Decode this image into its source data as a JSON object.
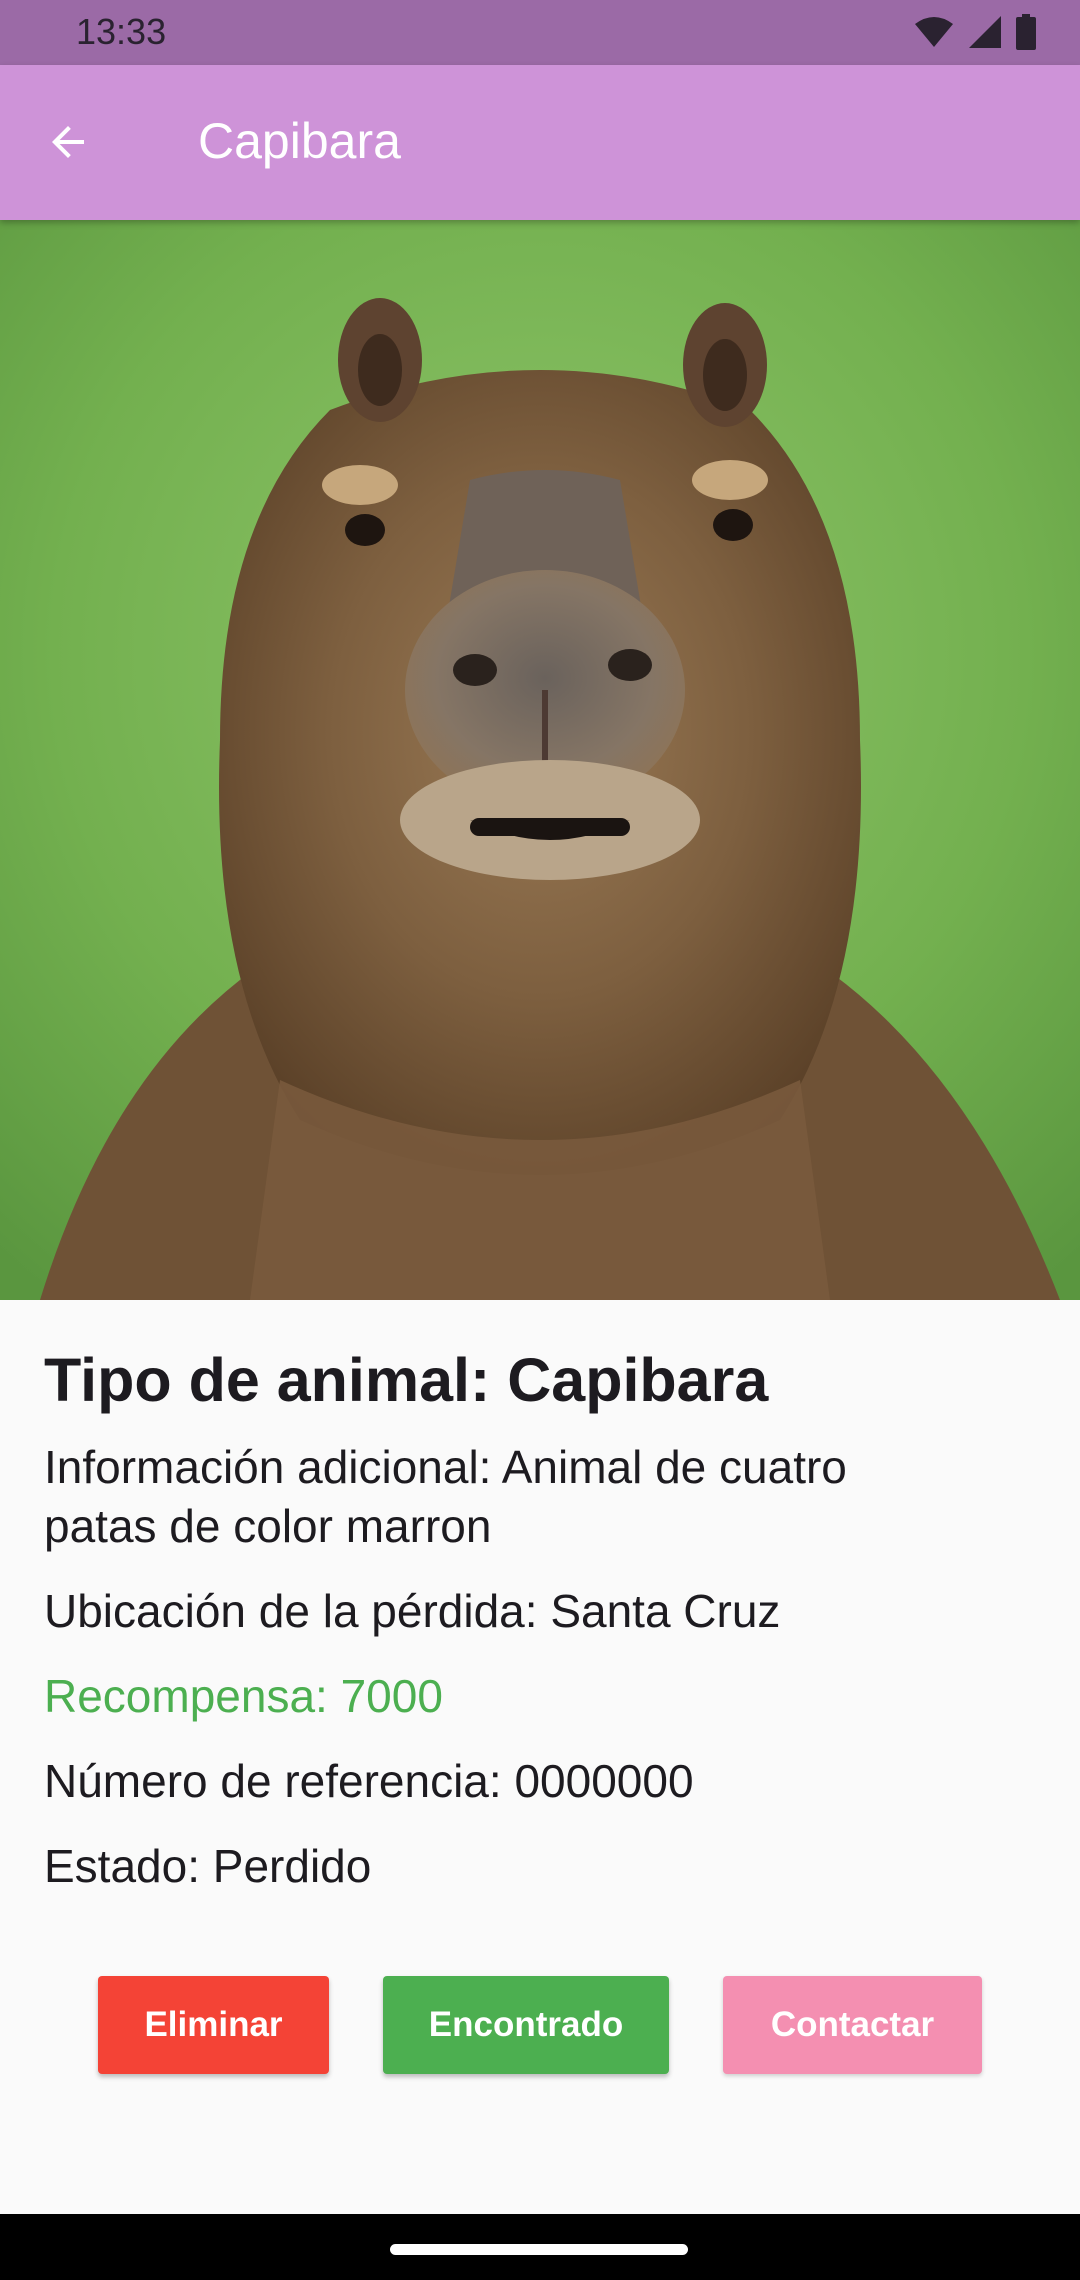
{
  "status_bar": {
    "time": "13:33",
    "icons": [
      "wifi-icon",
      "signal-icon",
      "battery-icon"
    ]
  },
  "app_bar": {
    "back_icon": "arrow-left-icon",
    "title": "Capibara"
  },
  "photo": {
    "subject": "capybara-photo"
  },
  "details": {
    "title": "Tipo de animal: Capibara",
    "info_line1": "Información adicional: Animal de cuatro",
    "info_line2": "patas de color marron",
    "location": "Ubicación de la pérdida: Santa Cruz",
    "reward": "Recompensa: 7000",
    "reference": "Número de referencia: 0000000",
    "status": "Estado: Perdido"
  },
  "buttons": {
    "delete_label": "Eliminar",
    "found_label": "Encontrado",
    "contact_label": "Contactar"
  },
  "colors": {
    "app_bar": "#ce93d8",
    "status_bar": "#9b6aa6",
    "reward_text": "#4caf50",
    "delete_button": "#f44336",
    "found_button": "#4caf50",
    "contact_button": "#f48fb1"
  }
}
